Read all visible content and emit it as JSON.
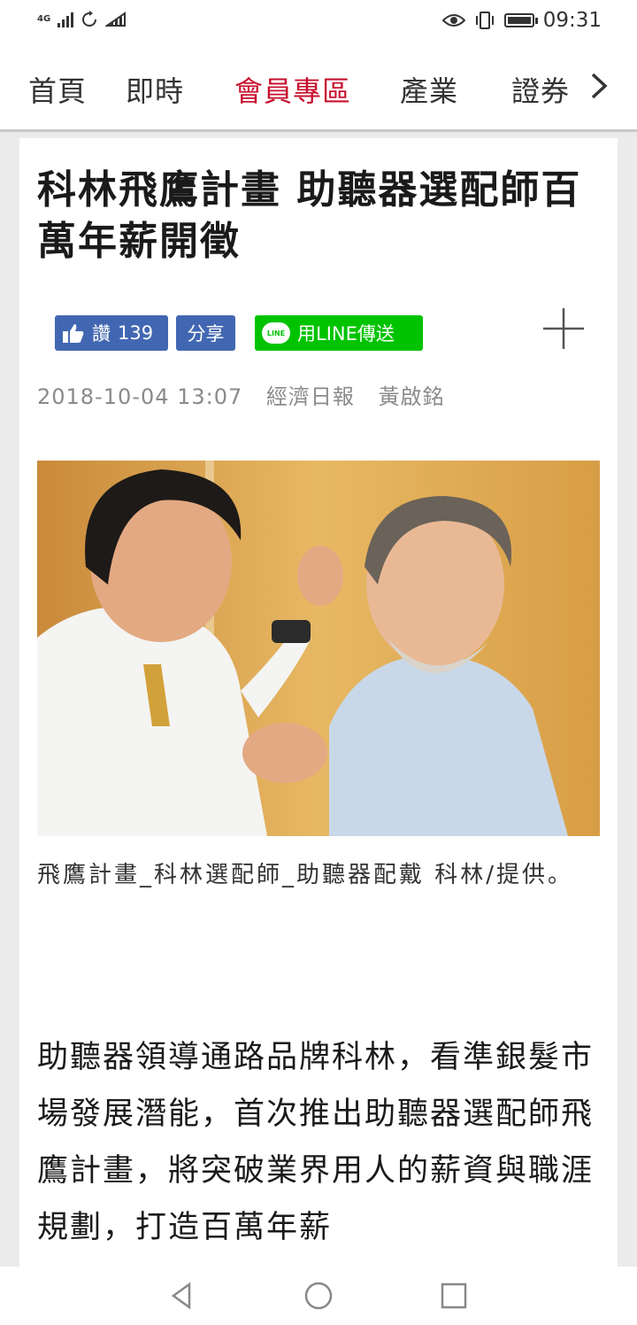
{
  "status_bar": {
    "network": "4G",
    "time": "09:31",
    "icons": [
      "signal-icon",
      "sync-icon",
      "wifi-icon",
      "eye-icon",
      "vibrate-icon",
      "battery-icon"
    ]
  },
  "nav": {
    "tabs": [
      {
        "label": "首頁",
        "active": false
      },
      {
        "label": "即時",
        "active": false
      },
      {
        "label": "會員專區",
        "active": true
      },
      {
        "label": "產業",
        "active": false
      },
      {
        "label": "證券",
        "active": false
      }
    ],
    "active_color": "#c8102e"
  },
  "article": {
    "title": "科林飛鷹計畫 助聽器選配師百萬年薪開徵",
    "like_label": "讚",
    "like_count": "139",
    "share_label": "分享",
    "line_label": "用LINE傳送",
    "line_badge": "LINE",
    "date": "2018-10-04 13:07",
    "source": "經濟日報",
    "author": "黃啟銘",
    "image_caption": "飛鷹計畫_科林選配師_助聽器配戴 科林/提供。",
    "body": "助聽器領導通路品牌科林，看準銀髮市場發展潛能，首次推出助聽器選配師飛鷹計畫，將突破業界用人的薪資與職涯規劃，打造百萬年薪"
  },
  "colors": {
    "facebook_blue": "#4267b2",
    "line_green": "#00c300",
    "page_bg": "#ebebeb"
  }
}
